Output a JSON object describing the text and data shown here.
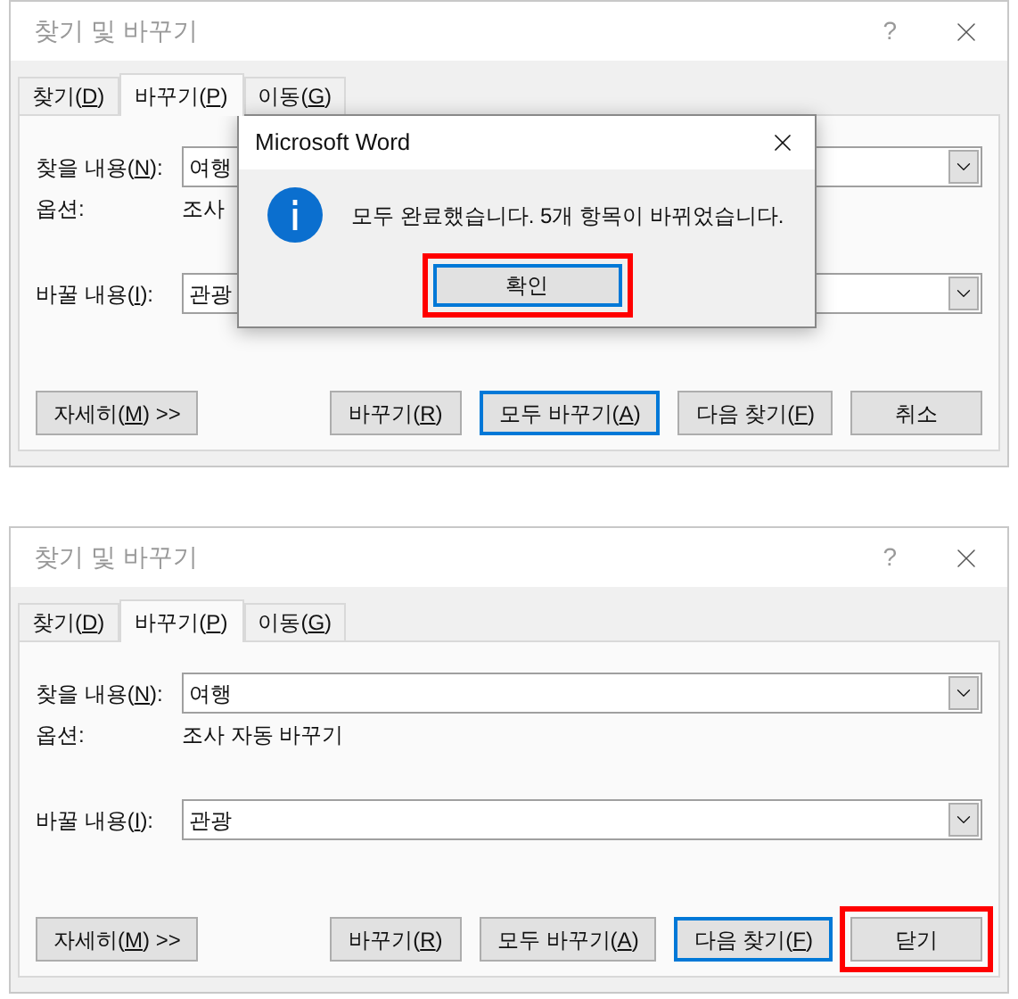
{
  "dialogs": [
    {
      "title": "찾기 및 바꾸기",
      "help": "?",
      "tabs": [
        {
          "label": {
            "before": "찾기(",
            "key": "D",
            "after": ")"
          },
          "selected": false
        },
        {
          "label": {
            "before": "바꾸기(",
            "key": "P",
            "after": ")"
          },
          "selected": true
        },
        {
          "label": {
            "before": "이동(",
            "key": "G",
            "after": ")"
          },
          "selected": false
        }
      ],
      "find": {
        "label": {
          "before": "찾을 내용(",
          "key": "N",
          "after": "):"
        },
        "value": "여행"
      },
      "options": {
        "label": "옵션:",
        "value": "조사"
      },
      "replace": {
        "label": {
          "before": "바꿀 내용(",
          "key": "I",
          "after": "):"
        },
        "value": "관광"
      },
      "buttons": [
        {
          "label": {
            "before": "자세히(",
            "key": "M",
            "after": ") >>"
          },
          "default": false,
          "highlighted": false
        },
        {
          "label": {
            "before": "바꾸기(",
            "key": "R",
            "after": ")"
          },
          "default": false,
          "highlighted": false
        },
        {
          "label": {
            "before": "모두 바꾸기(",
            "key": "A",
            "after": ")"
          },
          "default": true,
          "highlighted": false
        },
        {
          "label": {
            "before": "다음 찾기(",
            "key": "F",
            "after": ")"
          },
          "default": false,
          "highlighted": false
        },
        {
          "label": {
            "before": "취소"
          },
          "default": false,
          "highlighted": false
        }
      ],
      "message_box": {
        "title": "Microsoft Word",
        "message": "모두 완료했습니다. 5개 항목이 바뀌었습니다.",
        "button": {
          "label": "확인",
          "default": true,
          "highlighted": true
        }
      }
    },
    {
      "title": "찾기 및 바꾸기",
      "help": "?",
      "tabs": [
        {
          "label": {
            "before": "찾기(",
            "key": "D",
            "after": ")"
          },
          "selected": false
        },
        {
          "label": {
            "before": "바꾸기(",
            "key": "P",
            "after": ")"
          },
          "selected": true
        },
        {
          "label": {
            "before": "이동(",
            "key": "G",
            "after": ")"
          },
          "selected": false
        }
      ],
      "find": {
        "label": {
          "before": "찾을 내용(",
          "key": "N",
          "after": "):"
        },
        "value": "여행"
      },
      "options": {
        "label": "옵션:",
        "value": "조사 자동 바꾸기"
      },
      "replace": {
        "label": {
          "before": "바꿀 내용(",
          "key": "I",
          "after": "):"
        },
        "value": "관광"
      },
      "buttons": [
        {
          "label": {
            "before": "자세히(",
            "key": "M",
            "after": ") >>"
          },
          "default": false,
          "highlighted": false
        },
        {
          "label": {
            "before": "바꾸기(",
            "key": "R",
            "after": ")"
          },
          "default": false,
          "highlighted": false
        },
        {
          "label": {
            "before": "모두 바꾸기(",
            "key": "A",
            "after": ")"
          },
          "default": false,
          "highlighted": false
        },
        {
          "label": {
            "before": "다음 찾기(",
            "key": "F",
            "after": ")"
          },
          "default": true,
          "highlighted": false
        },
        {
          "label": {
            "before": "닫기"
          },
          "default": false,
          "highlighted": true
        }
      ]
    }
  ]
}
